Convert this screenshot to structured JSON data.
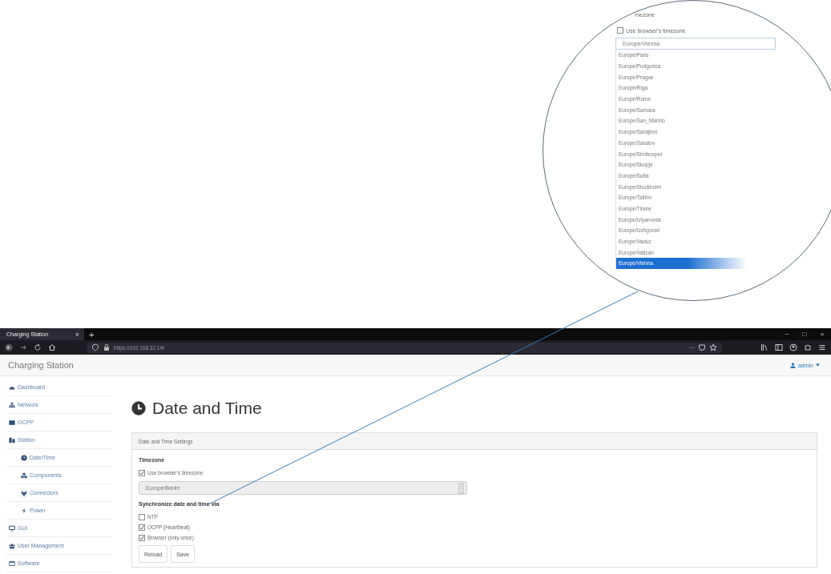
{
  "magnifier": {
    "timezone_label": "mezone",
    "use_browser_timezone": {
      "label": "Use browser's timezone",
      "checked": false
    },
    "select_value": "Europe/Vienna",
    "options": [
      {
        "label": "Europe/Paris",
        "selected": false
      },
      {
        "label": "Europe/Podgorica",
        "selected": false
      },
      {
        "label": "Europe/Prague",
        "selected": false
      },
      {
        "label": "Europe/Riga",
        "selected": false
      },
      {
        "label": "Europe/Rome",
        "selected": false
      },
      {
        "label": "Europe/Samara",
        "selected": false
      },
      {
        "label": "Europe/San_Marino",
        "selected": false
      },
      {
        "label": "Europe/Sarajevo",
        "selected": false
      },
      {
        "label": "Europe/Saratov",
        "selected": false
      },
      {
        "label": "Europe/Simferopol",
        "selected": false
      },
      {
        "label": "Europe/Skopje",
        "selected": false
      },
      {
        "label": "Europe/Sofia",
        "selected": false
      },
      {
        "label": "Europe/Stockholm",
        "selected": false
      },
      {
        "label": "Europe/Tallinn",
        "selected": false
      },
      {
        "label": "Europe/Tirane",
        "selected": false
      },
      {
        "label": "Europe/Ulyanovsk",
        "selected": false
      },
      {
        "label": "Europe/Uzhgorod",
        "selected": false
      },
      {
        "label": "Europe/Vaduz",
        "selected": false
      },
      {
        "label": "Europe/Vatican",
        "selected": false
      },
      {
        "label": "Europe/Vienna",
        "selected": true
      }
    ]
  },
  "browser": {
    "tab": {
      "title": "Charging Station",
      "close": "×"
    },
    "new_tab": "+",
    "window_controls": [
      "−",
      "□",
      "×"
    ],
    "url": "https://192.168.32.1/#",
    "page_actions": "···"
  },
  "navbar": {
    "brand": "Charging Station",
    "user": "admin"
  },
  "sidebar": {
    "items": [
      {
        "label": "Dashboard"
      },
      {
        "label": "Network"
      },
      {
        "label": "OCPP"
      },
      {
        "label": "Station",
        "children": [
          {
            "label": "Date/Time"
          },
          {
            "label": "Components"
          },
          {
            "label": "Connectors"
          },
          {
            "label": "Power"
          }
        ]
      },
      {
        "label": "GUI"
      },
      {
        "label": "User Management"
      },
      {
        "label": "Software"
      }
    ]
  },
  "main": {
    "heading": "Date and Time",
    "panel_title": "Date and Time Settings",
    "timezone_label": "Timezone",
    "use_browser_timezone": {
      "label": "Use browser's timezone",
      "checked": true
    },
    "timezone_select": {
      "value": "Europe/Berlin",
      "disabled": true
    },
    "sync_label": "Synchronize date and time via",
    "sync_options": [
      {
        "label": "NTP",
        "checked": false
      },
      {
        "label": "OCPP (Heartbeat)",
        "checked": true
      },
      {
        "label": "Browser (only once)",
        "checked": true
      }
    ],
    "buttons": [
      "Reload",
      "Save"
    ]
  }
}
